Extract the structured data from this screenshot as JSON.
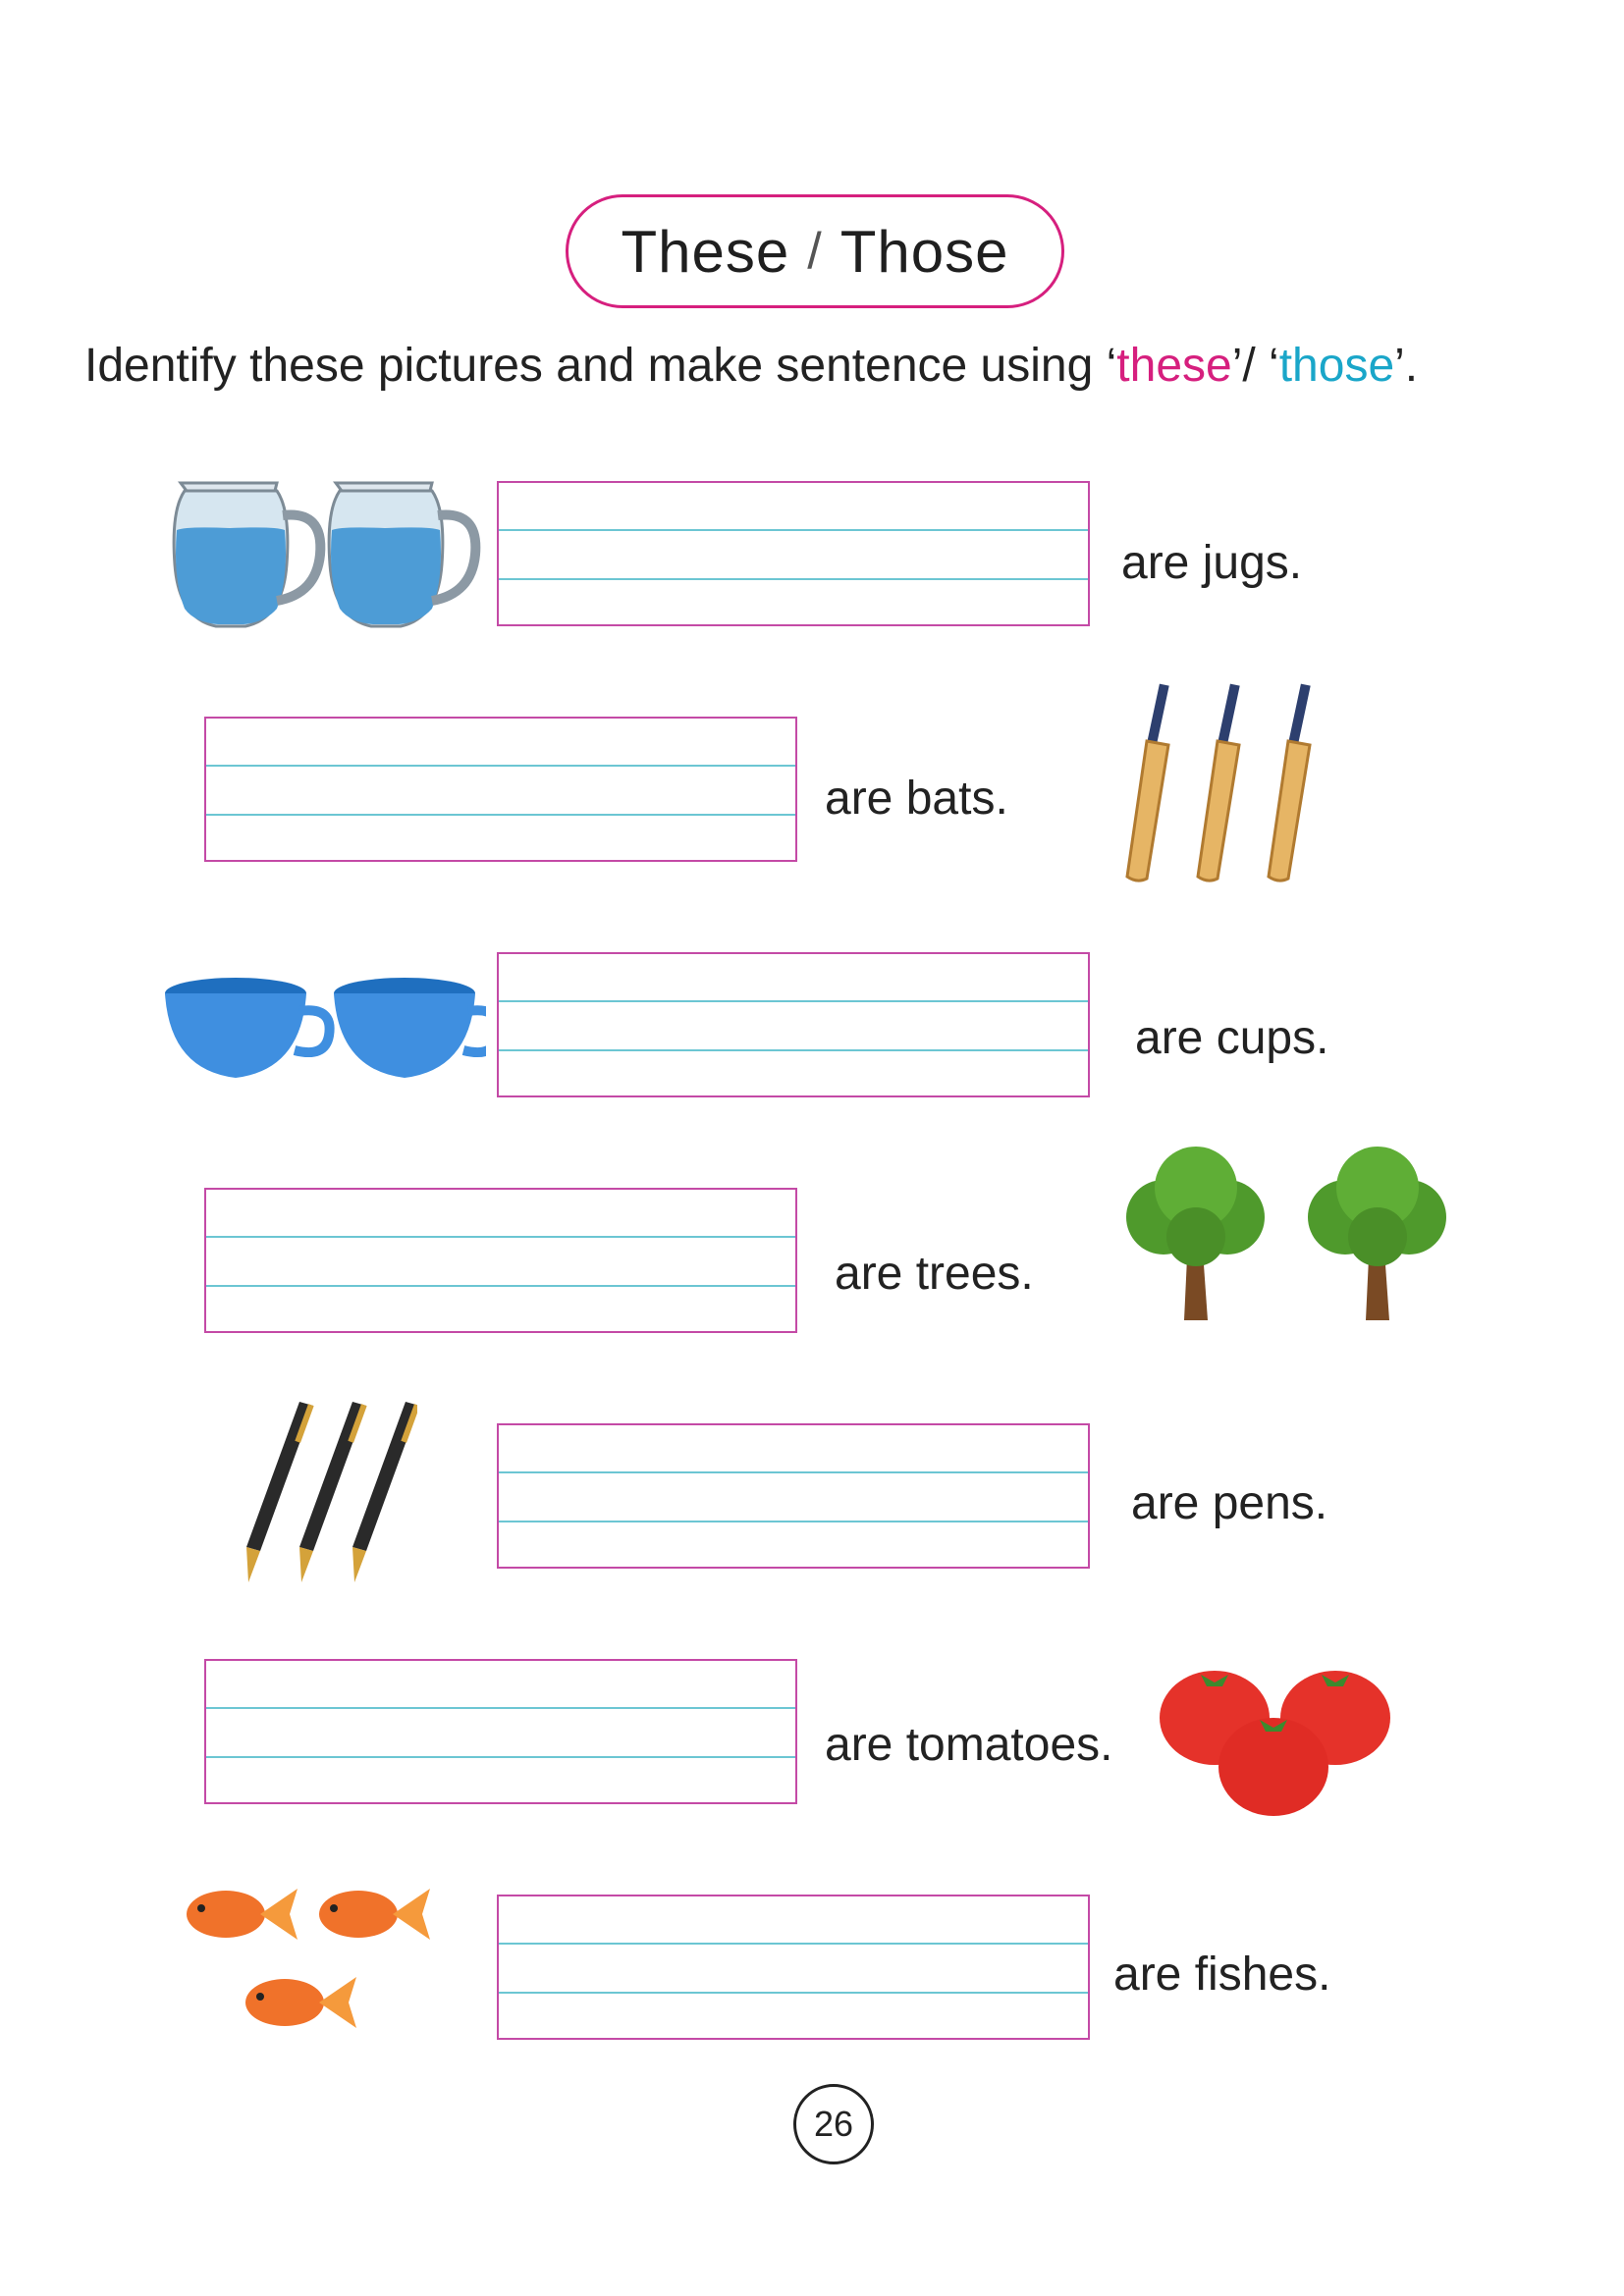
{
  "title": {
    "left": "These",
    "separator": "/",
    "right": "Those"
  },
  "instruction": {
    "prefix": "Identify these pictures and make sentence using ‘",
    "these": "these",
    "middle": "’/ ‘",
    "those": "those",
    "suffix": "’."
  },
  "rows": [
    {
      "picture": "jugs-picture",
      "sentence": "are jugs."
    },
    {
      "picture": "bats-picture",
      "sentence": "are bats."
    },
    {
      "picture": "cups-picture",
      "sentence": "are cups."
    },
    {
      "picture": "trees-picture",
      "sentence": "are trees."
    },
    {
      "picture": "pens-picture",
      "sentence": "are pens."
    },
    {
      "picture": "tomatoes-picture",
      "sentence": "are tomatoes."
    },
    {
      "picture": "fishes-picture",
      "sentence": "are fishes."
    }
  ],
  "page_number": "26",
  "colors": {
    "accent_pink": "#d61f7e",
    "accent_blue": "#1aa6c9",
    "box_border": "#c44aa6",
    "ruled_line": "#6cc6d3"
  }
}
